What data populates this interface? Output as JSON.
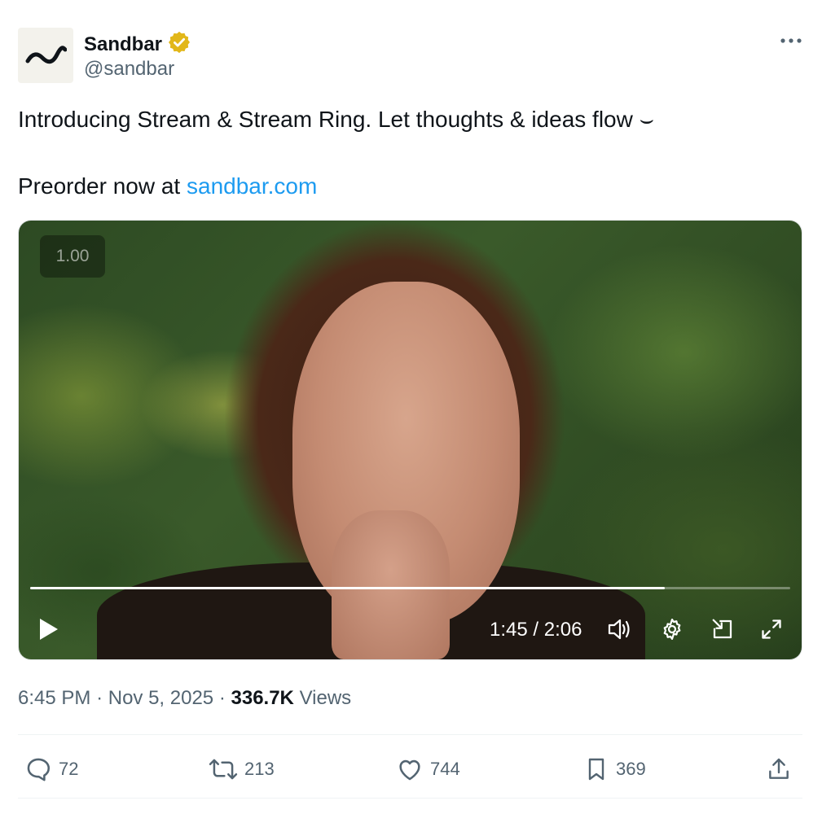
{
  "author": {
    "display_name": "Sandbar",
    "handle": "@sandbar",
    "verified_badge_color": "#e2b719"
  },
  "tweet": {
    "text_line1": "Introducing Stream & Stream Ring. Let thoughts & ideas flow ⌣",
    "text_line2_prefix": "Preorder now at ",
    "link_text": "sandbar.com"
  },
  "video": {
    "speed_label": "1.00",
    "progress_fraction": 0.835,
    "time_display": "1:45 / 2:06"
  },
  "meta": {
    "time": "6:45 PM",
    "date": "Nov 5, 2025",
    "views_count": "336.7K",
    "views_label": "Views"
  },
  "actions": {
    "replies": "72",
    "reposts": "213",
    "likes": "744",
    "bookmarks": "369"
  },
  "colors": {
    "link": "#1d9bf0",
    "secondary_text": "#536471",
    "primary_text": "#0f1419"
  }
}
